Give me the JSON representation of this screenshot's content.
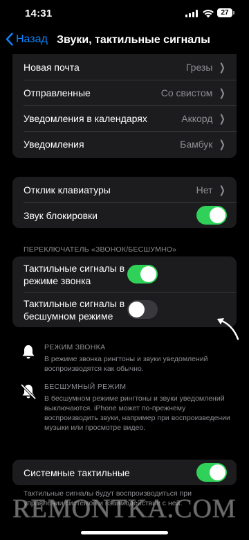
{
  "status_bar": {
    "time": "14:31",
    "battery": "27"
  },
  "nav": {
    "back_label": "Назад",
    "title": "Звуки, тактильные сигналы"
  },
  "sounds_group": {
    "items": [
      {
        "label": "Новая почта",
        "value": "Грезы"
      },
      {
        "label": "Отправленные",
        "value": "Со свистом"
      },
      {
        "label": "Уведомления в календарях",
        "value": "Аккорд"
      },
      {
        "label": "Уведомления",
        "value": "Бамбук"
      }
    ]
  },
  "keyboard_group": {
    "keyboard_feedback": {
      "label": "Отклик клавиатуры",
      "value": "Нет"
    },
    "lock_sound": {
      "label": "Звук блокировки",
      "state": "on"
    }
  },
  "switch_section": {
    "header": "ПЕРЕКЛЮЧАТЕЛЬ «ЗВОНОК/БЕСШУМНО»",
    "ring_haptics": {
      "label": "Тактильные сигналы в режиме звонка",
      "state": "on"
    },
    "silent_haptics": {
      "label": "Тактильные сигналы в бесшумном режиме",
      "state": "off"
    }
  },
  "info": {
    "ring_mode": {
      "title": "РЕЖИМ ЗВОНКА",
      "text": "В режиме звонка рингтоны и звуки уведомлений воспроизводятся как обычно.",
      "icon": "bell-icon"
    },
    "silent_mode": {
      "title": "БЕСШУМНЫЙ РЕЖИМ",
      "text": "В бесшумном режиме рингтоны и звуки уведомлений выключаются. iPhone может по-прежнему воспроизводить звуки, например при воспроизведении музыки или просмотре видео.",
      "icon": "bell-slash-icon"
    }
  },
  "system_haptics": {
    "label": "Системные тактильные",
    "state": "on",
    "footer": "Тактильные сигналы будут воспроизводиться при управлении системой и взаимодействии с ней."
  },
  "watermark": "REMONTKA.COM",
  "colors": {
    "accent": "#0a84ff",
    "toggle_on": "#30d158",
    "cell_bg": "#1c1c1e"
  }
}
